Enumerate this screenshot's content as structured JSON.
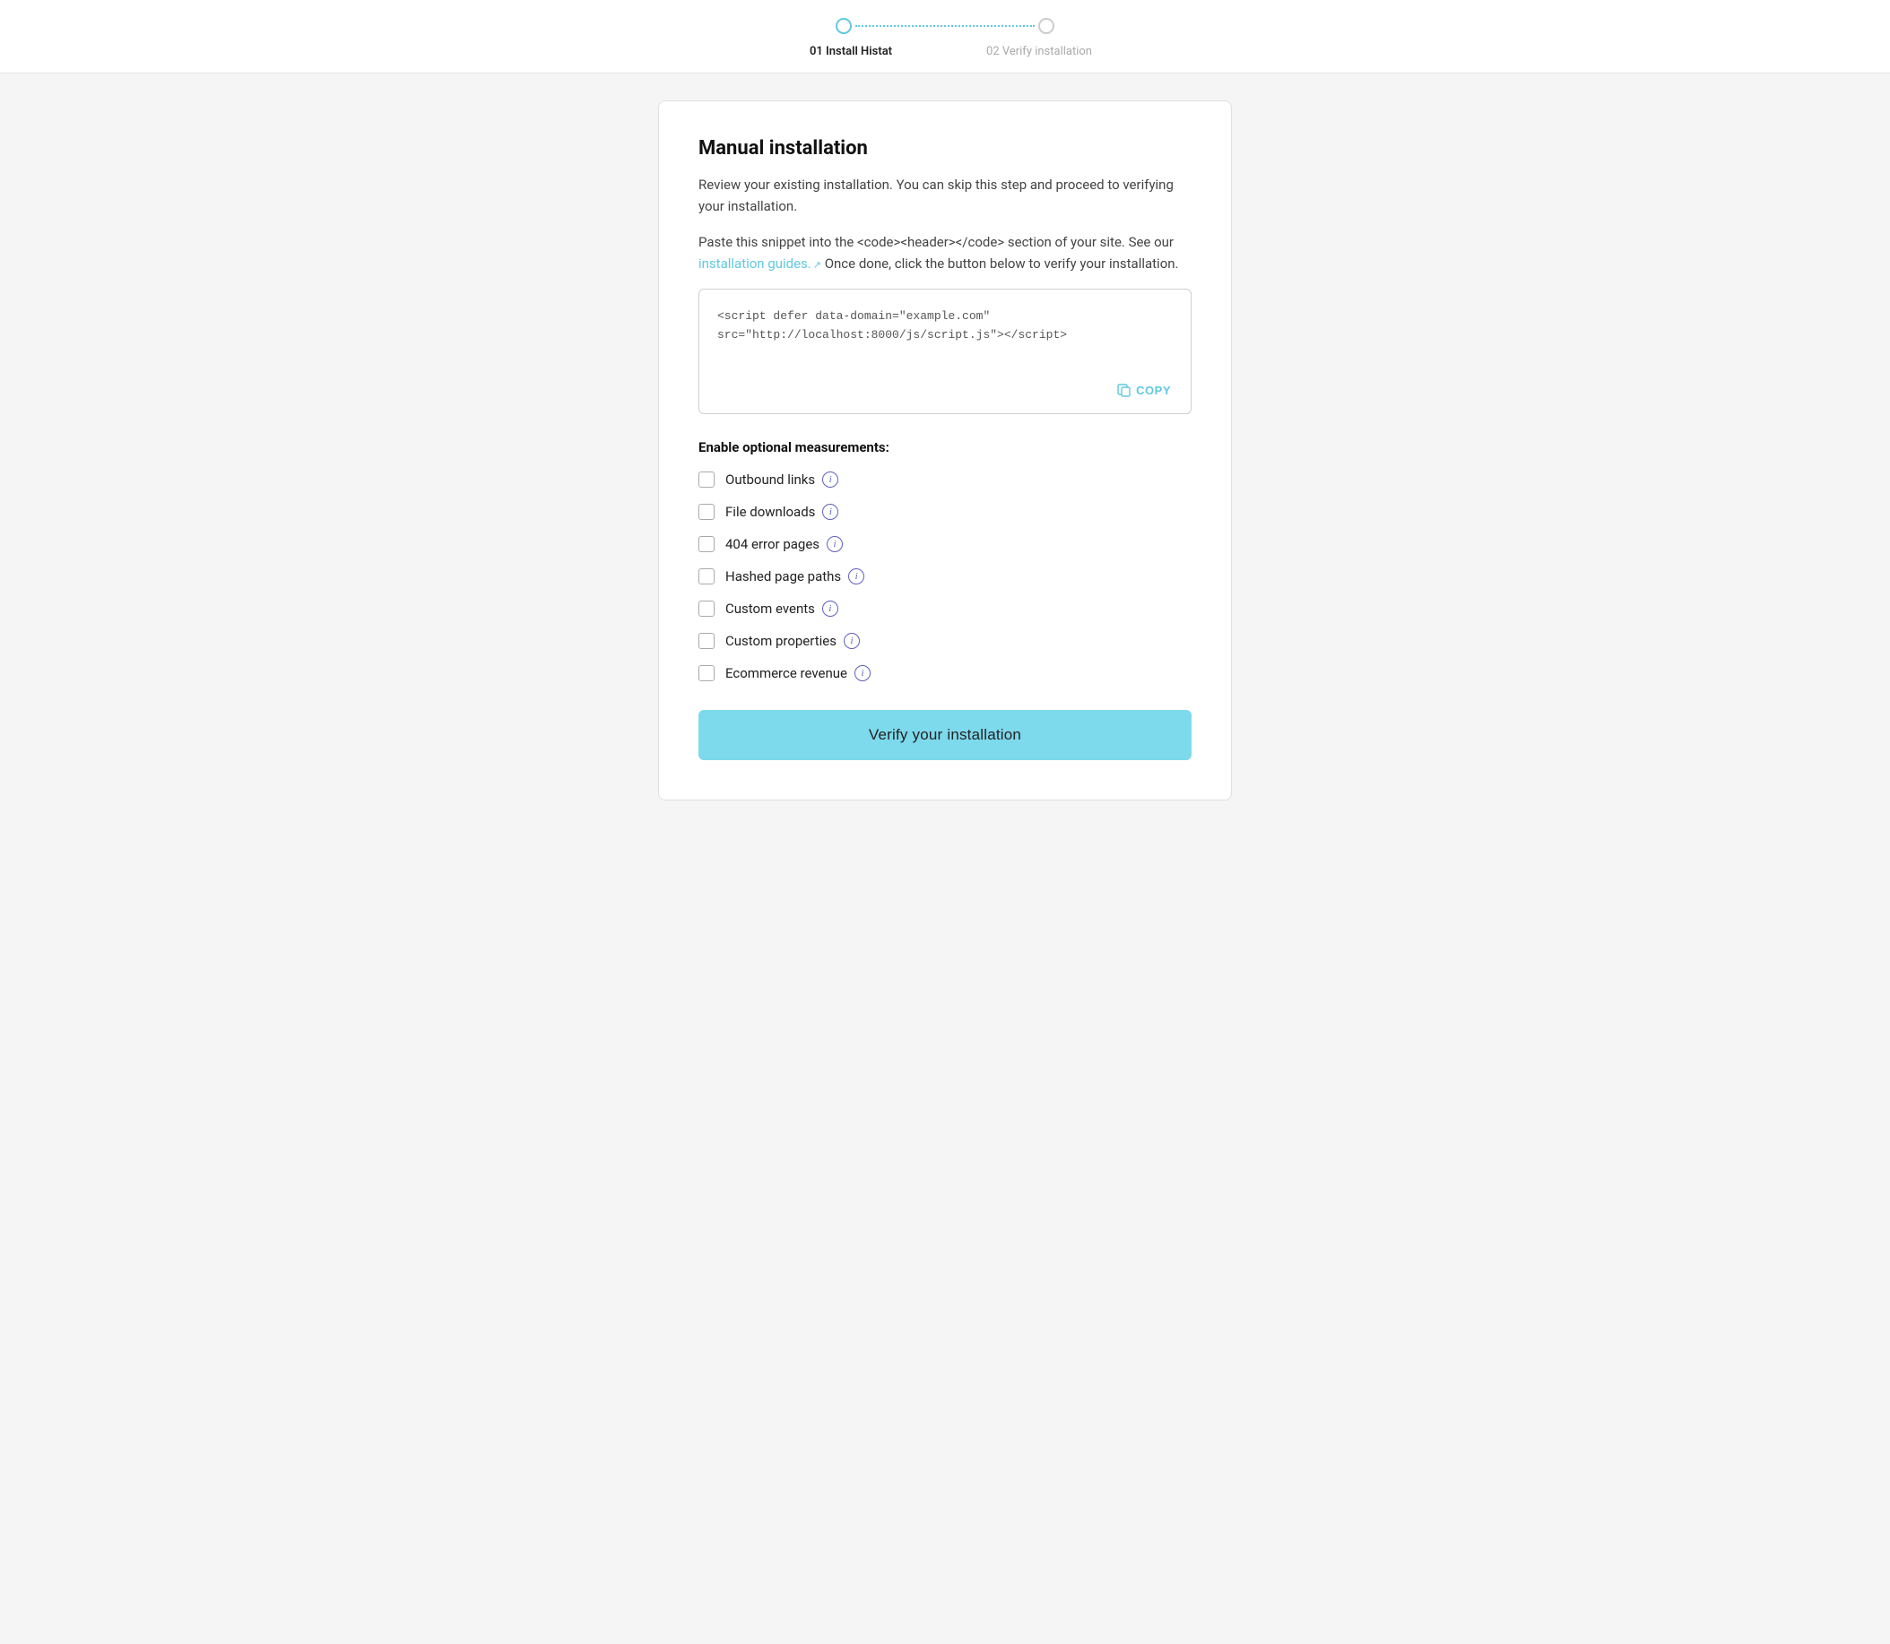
{
  "header": {
    "step1": {
      "label": "01 Install Histat",
      "active": true
    },
    "step2": {
      "label": "02 Verify installation",
      "active": false
    }
  },
  "main": {
    "title": "Manual installation",
    "desc1": "Review your existing installation. You can skip this step and proceed to verifying your installation.",
    "desc2_before": "Paste this snippet into the <code><header></code> section of your site. See our ",
    "desc2_link": "installation guides.",
    "desc2_after": " Once done, click the button below to verify your installation.",
    "code_snippet": "<script defer data-domain=\"example.com\"\nsrc=\"http://localhost:8000/js/script.js\"></script>",
    "copy_label": "COPY",
    "measurements_title": "Enable optional measurements:",
    "checkboxes": [
      {
        "id": "outbound",
        "label": "Outbound links"
      },
      {
        "id": "filedownloads",
        "label": "File downloads"
      },
      {
        "id": "404pages",
        "label": "404 error pages"
      },
      {
        "id": "hashed",
        "label": "Hashed page paths"
      },
      {
        "id": "customevents",
        "label": "Custom events"
      },
      {
        "id": "customprops",
        "label": "Custom properties"
      },
      {
        "id": "ecommerce",
        "label": "Ecommerce revenue"
      }
    ],
    "verify_button": "Verify your installation"
  }
}
